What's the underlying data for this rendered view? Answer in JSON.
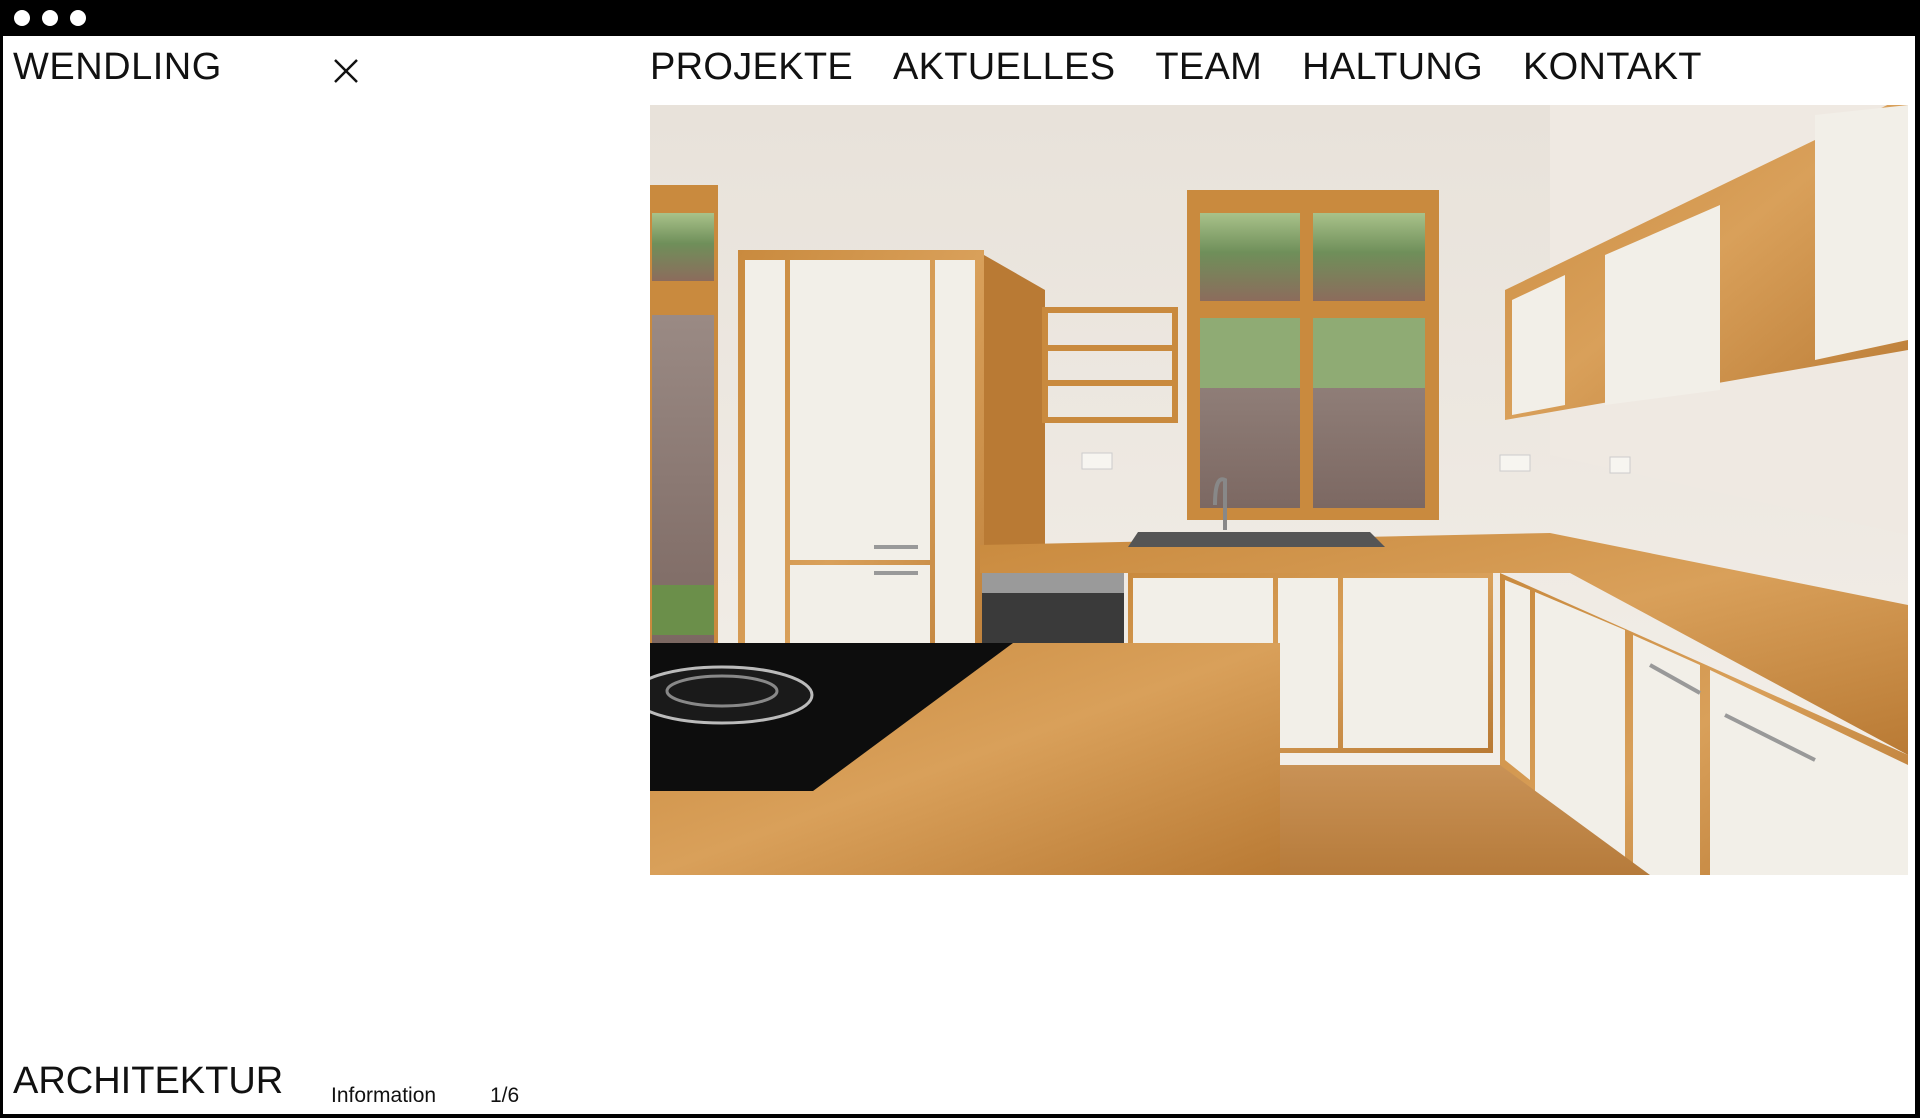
{
  "site": {
    "logo": "WENDLING",
    "nav": [
      "PROJEKTE",
      "AKTUELLES",
      "TEAM",
      "HALTUNG",
      "KONTAKT"
    ]
  },
  "project": {
    "category": "ARCHITEKTUR",
    "info_label": "Information",
    "counter": "1/6"
  },
  "icons": {
    "close": "close-icon"
  },
  "colors": {
    "text": "#111111",
    "background": "#ffffff",
    "frame": "#000000"
  }
}
